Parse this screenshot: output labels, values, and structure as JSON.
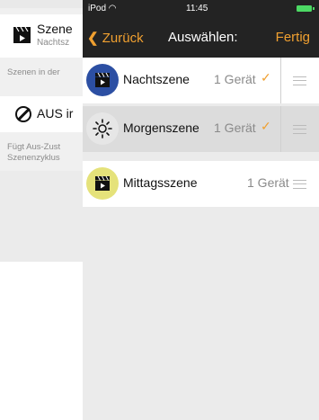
{
  "status_bar": {
    "carrier": "iPod",
    "time": "11:45"
  },
  "navbar": {
    "back_label": "Zurück",
    "title": "Auswählen:",
    "done_label": "Fertig"
  },
  "background": {
    "scene_title": "Szene",
    "scene_subtitle": "Nachtsz",
    "section_note": "Szenen in der",
    "off_title": "AUS ir",
    "footer_line1": "Fügt Aus-Zust",
    "footer_line2": "Szenenzyklus"
  },
  "scenes": [
    {
      "name": "Nachtszene",
      "count": "1 Gerät",
      "selected": true,
      "icon": "clapperboard-icon",
      "icon_bg": "#2c4fa3"
    },
    {
      "name": "Morgenszene",
      "count": "1 Gerät",
      "selected": true,
      "icon": "sun-icon",
      "icon_bg": "#dcdcdc"
    },
    {
      "name": "Mittagsszene",
      "count": "1 Gerät",
      "selected": false,
      "icon": "clapperboard-icon",
      "icon_bg": "#e5e27a"
    }
  ],
  "colors": {
    "accent": "#f0a030",
    "navbar_bg": "#232323"
  }
}
